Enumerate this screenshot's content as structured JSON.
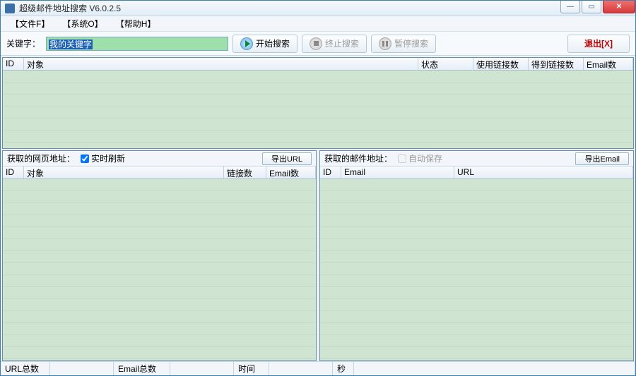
{
  "window": {
    "title": "超级邮件地址搜索  V6.0.2.5"
  },
  "menu": {
    "file": "【文件F】",
    "system": "【系统O】",
    "help": "【帮助H】"
  },
  "toolbar": {
    "keyword_label": "关键字：",
    "keyword_value": "我的关键字",
    "start": "开始搜索",
    "stop": "终止搜索",
    "pause": "暂停搜索",
    "exit": "退出[X]"
  },
  "grid_top": {
    "cols": {
      "id": "ID",
      "target": "对象",
      "status": "状态",
      "used_links": "使用链接数",
      "got_links": "得到链接数",
      "emails": "Email数"
    }
  },
  "panel_left": {
    "title": "获取的网页地址：",
    "realtime": "实时刷新",
    "realtime_checked": true,
    "export": "导出URL",
    "cols": {
      "id": "ID",
      "target": "对象",
      "links": "链接数",
      "emails": "Email数"
    }
  },
  "panel_right": {
    "title": "获取的邮件地址：",
    "autosave": "自动保存",
    "autosave_checked": false,
    "export": "导出Email",
    "cols": {
      "id": "ID",
      "email": "Email",
      "url": "URL"
    }
  },
  "status": {
    "url_total": "URL总数",
    "url_total_val": "",
    "email_total": "Email总数",
    "email_total_val": "",
    "time": "时间",
    "time_val": "",
    "sec": "秒"
  }
}
